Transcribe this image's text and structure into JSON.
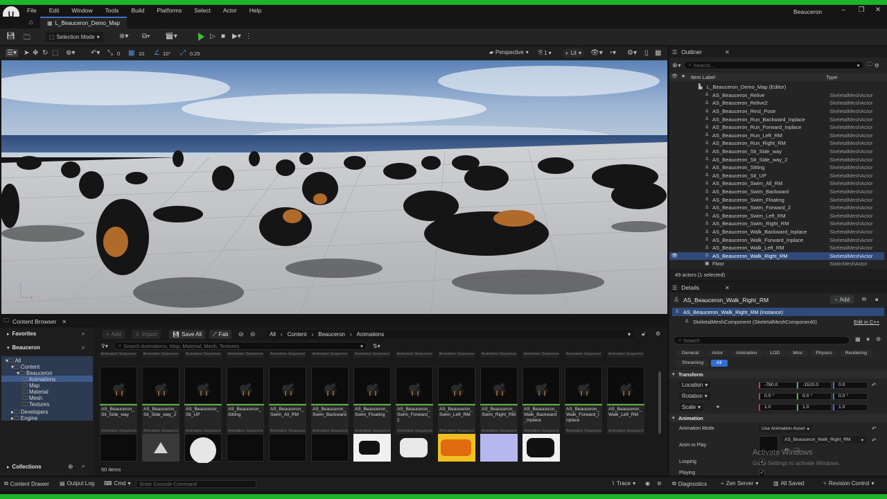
{
  "menu": {
    "items": [
      "File",
      "Edit",
      "Window",
      "Tools",
      "Build",
      "Platforms",
      "Select",
      "Actor",
      "Help"
    ],
    "project": "Beauceron"
  },
  "tab": {
    "map": "L_Beauceron_Demo_Map"
  },
  "toolbar": {
    "selection_mode": "Selection Mode"
  },
  "viewport": {
    "snap_angle": "0",
    "snap_loc": "10",
    "snap_rot": "10°",
    "snap_scale": "0.25",
    "perspective": "Perspective",
    "view_count": "1",
    "lit": "Lit"
  },
  "outliner": {
    "title": "Outliner",
    "search_placeholder": "Search...",
    "col_label": "Item Label",
    "col_type": "Type",
    "root": "L_Beauceron_Demo_Map (Editor)",
    "rows": [
      {
        "label": "AS_Beauceron_Relive",
        "type": "SkeletalMeshActor"
      },
      {
        "label": "AS_Beauceron_Relive2",
        "type": "SkeletalMeshActor"
      },
      {
        "label": "AS_Beauceron_Rest_Pose",
        "type": "SkeletalMeshActor"
      },
      {
        "label": "AS_Beauceron_Run_Backward_Inplace",
        "type": "SkeletalMeshActor"
      },
      {
        "label": "AS_Beauceron_Run_Forward_Inplace",
        "type": "SkeletalMeshActor"
      },
      {
        "label": "AS_Beauceron_Run_Left_RM",
        "type": "SkeletalMeshActor"
      },
      {
        "label": "AS_Beauceron_Run_Right_RM",
        "type": "SkeletalMeshActor"
      },
      {
        "label": "AS_Beauceron_Sit_Side_way",
        "type": "SkeletalMeshActor"
      },
      {
        "label": "AS_Beauceron_Sit_Side_way_2",
        "type": "SkeletalMeshActor"
      },
      {
        "label": "AS_Beauceron_Sitting",
        "type": "SkeletalMeshActor"
      },
      {
        "label": "AS_Beauceron_Sit_UP",
        "type": "SkeletalMeshActor"
      },
      {
        "label": "AS_Beauceron_Swim_All_RM",
        "type": "SkeletalMeshActor"
      },
      {
        "label": "AS_Beauceron_Swim_Backward",
        "type": "SkeletalMeshActor"
      },
      {
        "label": "AS_Beauceron_Swim_Floating",
        "type": "SkeletalMeshActor"
      },
      {
        "label": "AS_Beauceron_Swim_Forward_2",
        "type": "SkeletalMeshActor"
      },
      {
        "label": "AS_Beauceron_Swim_Left_RM",
        "type": "SkeletalMeshActor"
      },
      {
        "label": "AS_Beauceron_Swim_Right_RM",
        "type": "SkeletalMeshActor"
      },
      {
        "label": "AS_Beauceron_Walk_Backward_Inplace",
        "type": "SkeletalMeshActor"
      },
      {
        "label": "AS_Beauceron_Walk_Forward_Inplace",
        "type": "SkeletalMeshActor"
      },
      {
        "label": "AS_Beauceron_Walk_Left_RM",
        "type": "SkeletalMeshActor"
      },
      {
        "label": "AS_Beauceron_Walk_Right_RM",
        "type": "SkeletalMeshActor"
      },
      {
        "label": "Floor",
        "type": "StaticMeshActor"
      }
    ],
    "footer": "49 actors (1 selected)"
  },
  "details": {
    "title": "Details",
    "actor": "AS_Beauceron_Walk_Right_RM",
    "add": "Add",
    "instance": "AS_Beauceron_Walk_Right_RM (Instance)",
    "component": "SkeletalMeshComponent (SkeletalMeshComponent0)",
    "edit_cpp": "Edit in C++",
    "search_placeholder": "Search",
    "tabs": [
      "General",
      "Actor",
      "Animation",
      "LOD",
      "Misc",
      "Physics",
      "Rendering"
    ],
    "tabs2": [
      "Streaming",
      "All"
    ],
    "transform": "Transform",
    "location": {
      "label": "Location",
      "x": "-780.0",
      "y": "-1520.0",
      "z": "0.0"
    },
    "rotation": {
      "label": "Rotation",
      "x": "0.0 °",
      "y": "0.0 °",
      "z": "0.0 °"
    },
    "scale": {
      "label": "Scale",
      "x": "1.0",
      "y": "1.0",
      "z": "1.0"
    },
    "animation": "Animation",
    "anim_mode_label": "Animation Mode",
    "anim_mode": "Use Animation Asset",
    "anim_to_play_label": "Anim to Play",
    "anim_to_play": "AS_Beauceron_Walk_Right_RM",
    "looping": "Looping",
    "playing": "Playing",
    "watermark1": "Activate Windows",
    "watermark2": "Go to Settings to activate Windows."
  },
  "content_browser": {
    "title": "Content Browser",
    "favorites": "Favorites",
    "project": "Beauceron",
    "tree": [
      "All",
      "Content",
      "Beauceron",
      "Animations",
      "Map",
      "Material",
      "Mesh",
      "Textures",
      "Developers",
      "Engine"
    ],
    "add": "Add",
    "import": "Import",
    "save_all": "Save All",
    "fab": "Fab",
    "path": [
      "All",
      "Content",
      "Beauceron",
      "Animations"
    ],
    "search_placeholder": "Search Animations, Map, Material, Mesh, Textures",
    "asset_type": "Animation Sequence",
    "assets": [
      "AS_Beauceron_Sit_Side_way",
      "AS_Beauceron_Sit_Side_way_2",
      "AS_Beauceron_Sit_UP",
      "AS_Beauceron_Sitting",
      "AS_Beauceron_Swim_All_RM",
      "AS_Beauceron_Swim_Backward",
      "AS_Beauceron_Swim_Floating",
      "AS_Beauceron_Swim_Forward_2",
      "AS_Beauceron_Swim_Left_RM",
      "AS_Beauceron_Swim_Right_RM",
      "AS_Beauceron_Walk_Backward_Inplace",
      "AS_Beauceron_Walk_Forward_Inplace",
      "AS_Beauceron_Walk_Left_RM"
    ],
    "count": "50 items",
    "collections": "Collections"
  },
  "statusbar": {
    "drawer": "Content Drawer",
    "output": "Output Log",
    "cmd": "Cmd",
    "console_placeholder": "Enter Console Command",
    "trace": "Trace",
    "diagnostics": "Diagnostics",
    "zen": "Zen Server",
    "saved": "All Saved",
    "revision": "Revision Control"
  }
}
